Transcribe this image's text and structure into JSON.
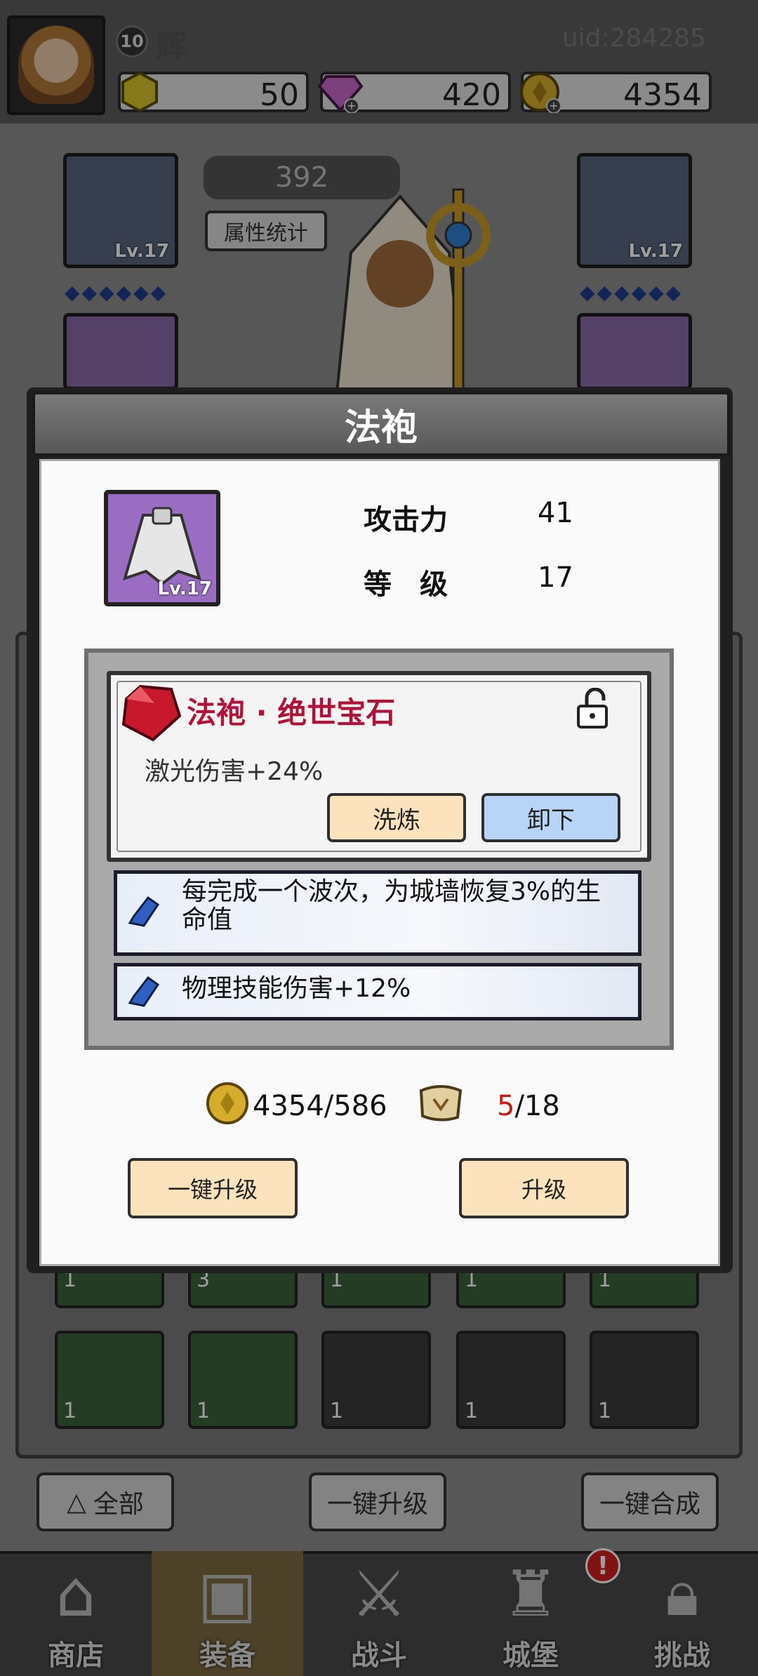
{
  "player": {
    "level": "10",
    "name": "辉",
    "uid": "uid:284285"
  },
  "resources": [
    {
      "icon": "crystal-icon",
      "value": "50"
    },
    {
      "icon": "gem-icon",
      "value": "420"
    },
    {
      "icon": "gold-coin-icon",
      "value": "4354"
    }
  ],
  "equipment_screen": {
    "power": "392",
    "stats_button": "属性统计",
    "slots": [
      {
        "name": "helmet",
        "level": "Lv.17"
      },
      {
        "name": "gloves",
        "level": "Lv.17"
      }
    ]
  },
  "modal": {
    "title": "法袍",
    "item_level_badge": "Lv.17",
    "stats": [
      {
        "label": "攻击力",
        "value": "41"
      },
      {
        "label": "等　级",
        "value": "17"
      }
    ],
    "gem": {
      "title": "法袍 · 绝世宝石",
      "effect": "激光伤害+24%",
      "refine_label": "洗炼",
      "unequip_label": "卸下"
    },
    "affixes": [
      {
        "text": "每完成一个波次，为城墙恢复3%的生命值"
      },
      {
        "text": "物理技能伤害+12%"
      }
    ],
    "cost": {
      "gold": "4354/586",
      "scroll_have": "5",
      "scroll_need": "/18"
    },
    "one_click_upgrade": "一键升级",
    "upgrade": "升级"
  },
  "inventory": {
    "counts": [
      "1",
      "3",
      "1",
      "1",
      "1",
      "1",
      "1",
      "1",
      "1",
      "1"
    ]
  },
  "bottom_buttons": {
    "filter": "全部",
    "upgrade_all": "一键升级",
    "merge_all": "一键合成"
  },
  "nav": [
    {
      "label": "商店",
      "icon": "shop-icon"
    },
    {
      "label": "装备",
      "icon": "backpack-icon"
    },
    {
      "label": "战斗",
      "icon": "crossed-swords-icon"
    },
    {
      "label": "城堡",
      "icon": "castle-icon"
    },
    {
      "label": "挑战",
      "icon": "locked-challenge-icon"
    }
  ],
  "nav_alert": "!",
  "colors": {
    "gem_title": "#b31238",
    "refine_button": "#fde3bd",
    "unequip_button": "#b8d4f6",
    "scroll_have": "#d01818"
  }
}
